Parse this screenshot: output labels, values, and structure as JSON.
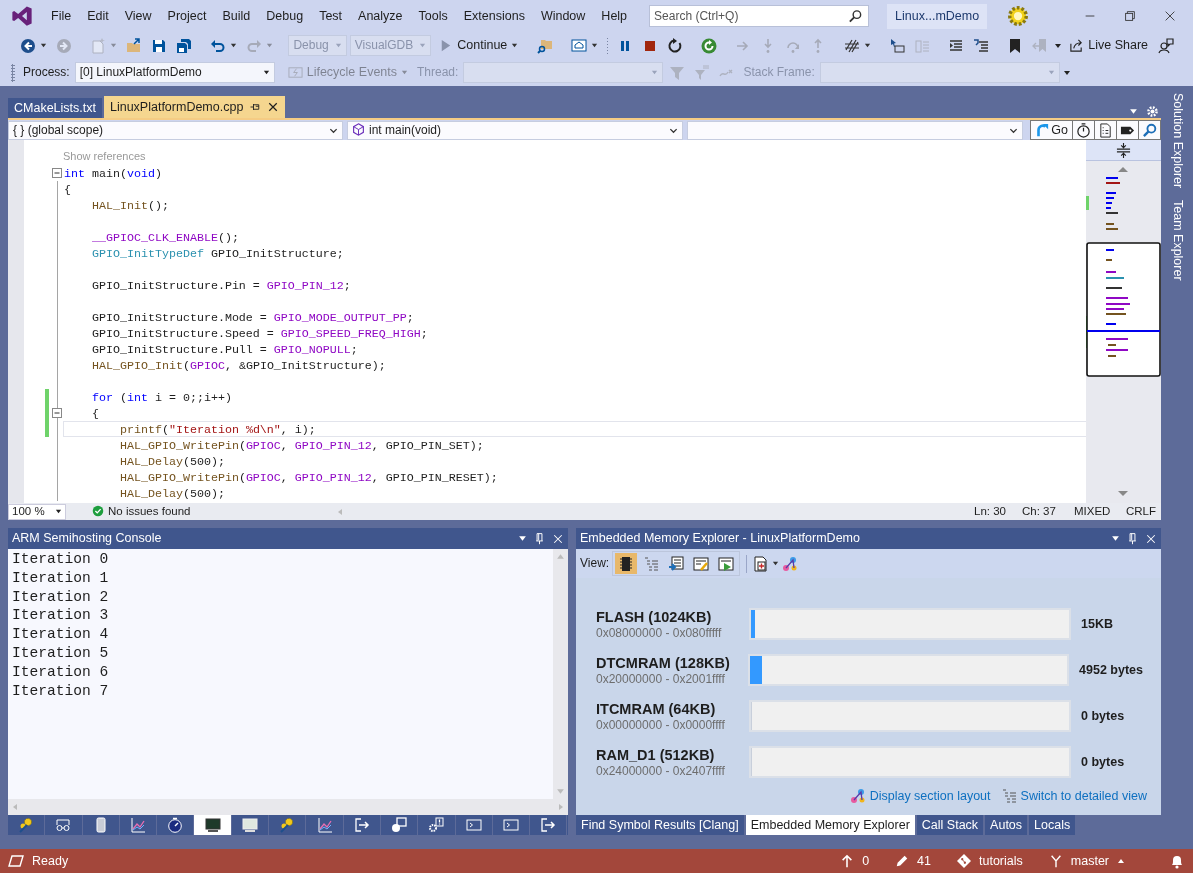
{
  "menu": [
    "File",
    "Edit",
    "View",
    "Project",
    "Build",
    "Debug",
    "Test",
    "Analyze",
    "Tools",
    "Extensions",
    "Window",
    "Help"
  ],
  "search": {
    "placeholder": "Search (Ctrl+Q)"
  },
  "solution_name": "Linux...mDemo",
  "toolbar": [
    {
      "kind": "grip"
    },
    {
      "kind": "icon",
      "disabled": false,
      "caret": true
    },
    {
      "kind": "icon",
      "disabled": true
    },
    {
      "kind": "sep"
    },
    {
      "kind": "icon",
      "disabled": true,
      "caret": true
    },
    {
      "kind": "icon",
      "disabled": false
    },
    {
      "kind": "icon",
      "disabled": false
    },
    {
      "kind": "icon",
      "disabled": false
    },
    {
      "kind": "sep"
    },
    {
      "kind": "icon",
      "disabled": false,
      "caret": true
    },
    {
      "kind": "icon",
      "disabled": true,
      "caret": true
    },
    {
      "kind": "sep"
    },
    {
      "kind": "combo",
      "label": "Debug",
      "disabled": true
    },
    {
      "kind": "combo",
      "label": "VisualGDB",
      "disabled": true
    },
    {
      "kind": "button",
      "label": "Continue",
      "disabled": false,
      "caret": true
    },
    {
      "kind": "sep"
    },
    {
      "kind": "icon",
      "disabled": false
    },
    {
      "kind": "sep"
    },
    {
      "kind": "icon",
      "disabled": false,
      "caret": true
    },
    {
      "kind": "grip"
    },
    {
      "kind": "icon",
      "disabled": false
    },
    {
      "kind": "icon",
      "disabled": false
    },
    {
      "kind": "icon",
      "disabled": false
    },
    {
      "kind": "sep"
    },
    {
      "kind": "icon",
      "disabled": false
    },
    {
      "kind": "sep"
    },
    {
      "kind": "icon",
      "disabled": true
    },
    {
      "kind": "icon",
      "disabled": true
    },
    {
      "kind": "icon",
      "disabled": true
    },
    {
      "kind": "icon",
      "disabled": true
    },
    {
      "kind": "sep"
    },
    {
      "kind": "icon",
      "disabled": false,
      "caret": true
    },
    {
      "kind": "grip"
    },
    {
      "kind": "icon",
      "disabled": false
    },
    {
      "kind": "icon",
      "disabled": true
    },
    {
      "kind": "sep"
    },
    {
      "kind": "icon",
      "disabled": false
    },
    {
      "kind": "icon",
      "disabled": false
    },
    {
      "kind": "sep"
    },
    {
      "kind": "icon",
      "disabled": false
    },
    {
      "kind": "icon",
      "disabled": true
    },
    {
      "kind": "overflow"
    },
    {
      "kind": "button",
      "label": "Live Share",
      "disabled": false
    },
    {
      "kind": "icon",
      "disabled": false
    }
  ],
  "debug_toolbar": [
    {
      "kind": "grip"
    },
    {
      "kind": "label",
      "label": "Process:",
      "disabled": false
    },
    {
      "kind": "combo",
      "label": "[0] LinuxPlatformDemo",
      "disabled": false
    },
    {
      "kind": "button",
      "label": "Lifecycle Events",
      "disabled": true,
      "caret": true
    },
    {
      "kind": "label",
      "label": "Thread:",
      "disabled": true
    },
    {
      "kind": "combo",
      "disabled": true
    },
    {
      "kind": "icon",
      "disabled": true
    },
    {
      "kind": "icon",
      "disabled": true
    },
    {
      "kind": "icon",
      "disabled": true
    },
    {
      "kind": "label",
      "label": "Stack Frame:",
      "disabled": true
    },
    {
      "kind": "combo",
      "disabled": true
    },
    {
      "kind": "overflow"
    }
  ],
  "tabs": [
    {
      "label": "CMakeLists.txt",
      "selected": false
    },
    {
      "label": "LinuxPlatformDemo.cpp",
      "selected": true
    }
  ],
  "navigation": {
    "scope": "{ } (global scope)",
    "member": "int main(void)",
    "go_label": "Go"
  },
  "code": {
    "lens": "Show references",
    "lines": [
      {
        "changed": false,
        "current": false,
        "fold": true,
        "segments": [
          {
            "text": "int",
            "kind": "keyword"
          },
          {
            "text": " main(",
            "kind": "plain"
          },
          {
            "text": "void",
            "kind": "keyword"
          },
          {
            "text": ")",
            "kind": "plain"
          }
        ]
      },
      {
        "changed": false,
        "current": false,
        "fold": false,
        "segments": [
          {
            "text": "{",
            "kind": "plain"
          }
        ]
      },
      {
        "changed": false,
        "current": false,
        "fold": false,
        "segments": [
          {
            "text": "    HAL_Init",
            "kind": "function"
          },
          {
            "text": "();",
            "kind": "plain"
          }
        ]
      },
      {
        "changed": false,
        "current": false,
        "fold": false
      },
      {
        "changed": false,
        "current": false,
        "fold": false,
        "segments": [
          {
            "text": "    __GPIOC_CLK_ENABLE",
            "kind": "macro"
          },
          {
            "text": "();",
            "kind": "plain"
          }
        ]
      },
      {
        "changed": false,
        "current": false,
        "fold": false,
        "segments": [
          {
            "text": "    GPIO_InitTypeDef",
            "kind": "type"
          },
          {
            "text": " GPIO_InitStructure;",
            "kind": "plain"
          }
        ]
      },
      {
        "changed": false,
        "current": false,
        "fold": false
      },
      {
        "changed": false,
        "current": false,
        "fold": false,
        "segments": [
          {
            "text": "    GPIO_InitStructure.Pin = ",
            "kind": "plain"
          },
          {
            "text": "GPIO_PIN_12",
            "kind": "macro"
          },
          {
            "text": ";",
            "kind": "plain"
          }
        ]
      },
      {
        "changed": false,
        "current": false,
        "fold": false
      },
      {
        "changed": false,
        "current": false,
        "fold": false,
        "segments": [
          {
            "text": "    GPIO_InitStructure.Mode = ",
            "kind": "plain"
          },
          {
            "text": "GPIO_MODE_OUTPUT_PP",
            "kind": "macro"
          },
          {
            "text": ";",
            "kind": "plain"
          }
        ]
      },
      {
        "changed": false,
        "current": false,
        "fold": false,
        "segments": [
          {
            "text": "    GPIO_InitStructure.Speed = ",
            "kind": "plain"
          },
          {
            "text": "GPIO_SPEED_FREQ_HIGH",
            "kind": "macro"
          },
          {
            "text": ";",
            "kind": "plain"
          }
        ]
      },
      {
        "changed": false,
        "current": false,
        "fold": false,
        "segments": [
          {
            "text": "    GPIO_InitStructure.Pull = ",
            "kind": "plain"
          },
          {
            "text": "GPIO_NOPULL",
            "kind": "macro"
          },
          {
            "text": ";",
            "kind": "plain"
          }
        ]
      },
      {
        "changed": false,
        "current": false,
        "fold": false,
        "segments": [
          {
            "text": "    HAL_GPIO_Init",
            "kind": "function"
          },
          {
            "text": "(",
            "kind": "plain"
          },
          {
            "text": "GPIOC",
            "kind": "macro"
          },
          {
            "text": ", &GPIO_InitStructure);",
            "kind": "plain"
          }
        ]
      },
      {
        "changed": false,
        "current": false,
        "fold": false
      },
      {
        "changed": true,
        "current": false,
        "fold": false,
        "segments": [
          {
            "text": "    for",
            "kind": "keyword"
          },
          {
            "text": " (",
            "kind": "plain"
          },
          {
            "text": "int",
            "kind": "keyword"
          },
          {
            "text": " i = 0;;i++)",
            "kind": "plain"
          }
        ]
      },
      {
        "changed": true,
        "current": false,
        "fold": true,
        "segments": [
          {
            "text": "    {",
            "kind": "plain"
          }
        ]
      },
      {
        "changed": true,
        "current": true,
        "fold": false,
        "segments": [
          {
            "text": "        printf",
            "kind": "function"
          },
          {
            "text": "(",
            "kind": "plain"
          },
          {
            "text": "\"Iteration %d\\n\"",
            "kind": "string"
          },
          {
            "text": ", i);",
            "kind": "plain"
          }
        ]
      },
      {
        "changed": false,
        "current": false,
        "fold": false,
        "segments": [
          {
            "text": "        HAL_GPIO_WritePin",
            "kind": "function"
          },
          {
            "text": "(",
            "kind": "plain"
          },
          {
            "text": "GPIOC",
            "kind": "macro"
          },
          {
            "text": ", ",
            "kind": "plain"
          },
          {
            "text": "GPIO_PIN_12",
            "kind": "macro"
          },
          {
            "text": ", GPIO_PIN_SET);",
            "kind": "plain"
          }
        ]
      },
      {
        "changed": false,
        "current": false,
        "fold": false,
        "segments": [
          {
            "text": "        HAL_Delay",
            "kind": "function"
          },
          {
            "text": "(500);",
            "kind": "plain"
          }
        ]
      },
      {
        "changed": false,
        "current": false,
        "fold": false,
        "segments": [
          {
            "text": "        HAL_GPIO_WritePin",
            "kind": "function"
          },
          {
            "text": "(",
            "kind": "plain"
          },
          {
            "text": "GPIOC",
            "kind": "macro"
          },
          {
            "text": ", ",
            "kind": "plain"
          },
          {
            "text": "GPIO_PIN_12",
            "kind": "macro"
          },
          {
            "text": ", GPIO_PIN_RESET);",
            "kind": "plain"
          }
        ]
      },
      {
        "changed": false,
        "current": false,
        "fold": false,
        "segments": [
          {
            "text": "        HAL_Delay",
            "kind": "function"
          },
          {
            "text": "(500);",
            "kind": "plain"
          }
        ]
      }
    ]
  },
  "editor_status": {
    "zoom": "100 %",
    "issues": "No issues found",
    "line": "Ln: 30",
    "column": "Ch: 37",
    "encoding": "MIXED",
    "line_endings": "CRLF"
  },
  "side_tabs": [
    "Solution Explorer",
    "Team Explorer"
  ],
  "console": {
    "title": "ARM Semihosting Console",
    "lines": [
      "Iteration 0",
      "Iteration 1",
      "Iteration 2",
      "Iteration 3",
      "Iteration 4",
      "Iteration 5",
      "Iteration 6",
      "Iteration 7"
    ],
    "tool_tabs": [
      {
        "selected": false
      },
      {
        "selected": false
      },
      {
        "selected": false
      },
      {
        "selected": false
      },
      {
        "selected": false
      },
      {
        "selected": true
      },
      {
        "selected": false
      },
      {
        "selected": false
      },
      {
        "selected": false
      },
      {
        "selected": false
      },
      {
        "selected": false
      },
      {
        "selected": false
      },
      {
        "selected": false
      },
      {
        "selected": false
      },
      {
        "selected": false
      }
    ]
  },
  "memory": {
    "title": "Embedded Memory Explorer - LinuxPlatformDemo",
    "view_label": "View:",
    "views": [
      {
        "selected": true
      },
      {
        "selected": false
      },
      {
        "selected": false
      },
      {
        "selected": false
      },
      {
        "selected": false
      }
    ],
    "regions": [
      {
        "name": "FLASH (1024KB)",
        "range": "0x08000000 - 0x080fffff",
        "level": 0.014,
        "usage": "15KB"
      },
      {
        "name": "DTCMRAM (128KB)",
        "range": "0x20000000 - 0x2001ffff",
        "level": 0.037,
        "usage": "4952 bytes"
      },
      {
        "name": "ITCMRAM (64KB)",
        "range": "0x00000000 - 0x0000ffff",
        "level": 0,
        "usage": "0 bytes"
      },
      {
        "name": "RAM_D1 (512KB)",
        "range": "0x24000000 - 0x2407ffff",
        "level": 0,
        "usage": "0 bytes"
      }
    ],
    "links": [
      "Display section layout",
      "Switch to detailed view"
    ],
    "tabs": [
      {
        "label": "Find Symbol Results [Clang]",
        "selected": false
      },
      {
        "label": "Embedded Memory Explorer",
        "selected": true
      },
      {
        "label": "Call Stack",
        "selected": false
      },
      {
        "label": "Autos",
        "selected": false
      },
      {
        "label": "Locals",
        "selected": false
      }
    ]
  },
  "status_bar": {
    "state": "Ready",
    "unpushed": "0",
    "changes": "41",
    "repository": "tutorials",
    "branch": "master"
  }
}
